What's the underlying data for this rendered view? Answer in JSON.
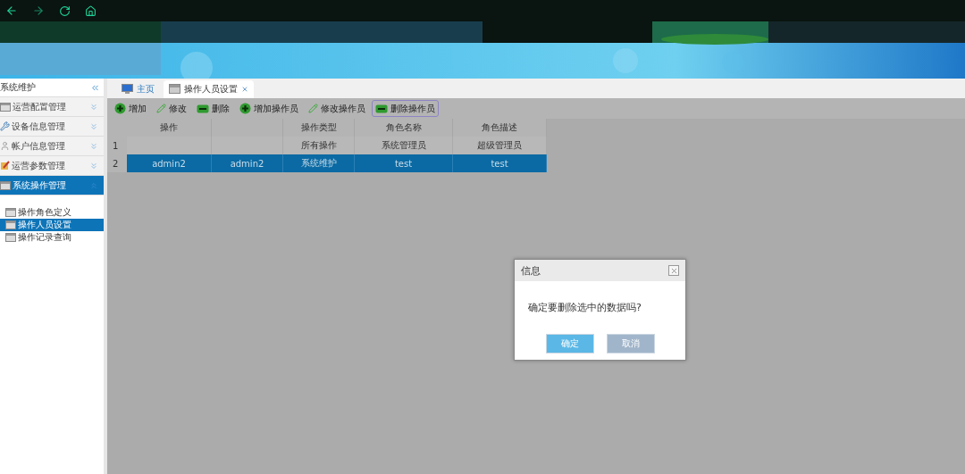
{
  "sidebar": {
    "title": "系统维护",
    "groups": [
      {
        "label": "运营配置管理",
        "kind": "window",
        "expanded": false,
        "selected": false
      },
      {
        "label": "设备信息管理",
        "kind": "tools",
        "expanded": false,
        "selected": false
      },
      {
        "label": "帐户信息管理",
        "kind": "user",
        "expanded": false,
        "selected": false
      },
      {
        "label": "运营参数管理",
        "kind": "edit",
        "expanded": false,
        "selected": false
      },
      {
        "label": "系统操作管理",
        "kind": "window",
        "expanded": true,
        "selected": true,
        "children": [
          {
            "label": "操作角色定义",
            "selected": false
          },
          {
            "label": "操作人员设置",
            "selected": true
          },
          {
            "label": "操作记录查询",
            "selected": false
          }
        ]
      }
    ]
  },
  "tabs": [
    {
      "label": "主页",
      "kind": "home",
      "selected": false,
      "closable": false
    },
    {
      "label": "操作人员设置",
      "kind": "page",
      "selected": true,
      "closable": true
    }
  ],
  "toolbar": [
    {
      "label": "增加",
      "kind": "add",
      "focused": false
    },
    {
      "label": "修改",
      "kind": "edit",
      "focused": false
    },
    {
      "label": "删除",
      "kind": "delete",
      "focused": false
    },
    {
      "label": "增加操作员",
      "kind": "add",
      "focused": false
    },
    {
      "label": "修改操作员",
      "kind": "edit",
      "focused": false
    },
    {
      "label": "删除操作员",
      "kind": "delete",
      "focused": true
    }
  ],
  "table": {
    "columns": [
      {
        "label": "操作"
      },
      {},
      {
        "label": "操作类型"
      },
      {
        "label": "角色名称"
      },
      {
        "label": "角色描述"
      }
    ],
    "rows": [
      {
        "number": "1",
        "selected": false,
        "cells": [
          null,
          null,
          "所有操作",
          "系统管理员",
          "超级管理员"
        ]
      },
      {
        "number": "2",
        "selected": true,
        "cells": [
          "admin2",
          "admin2",
          "系统维护",
          "test",
          "test"
        ]
      }
    ]
  },
  "dialog": {
    "title": "信息",
    "message": "确定要删除选中的数据吗?",
    "buttons": [
      {
        "label": "确定",
        "kind": "primary"
      },
      {
        "label": "取消",
        "kind": "secondary"
      }
    ]
  }
}
